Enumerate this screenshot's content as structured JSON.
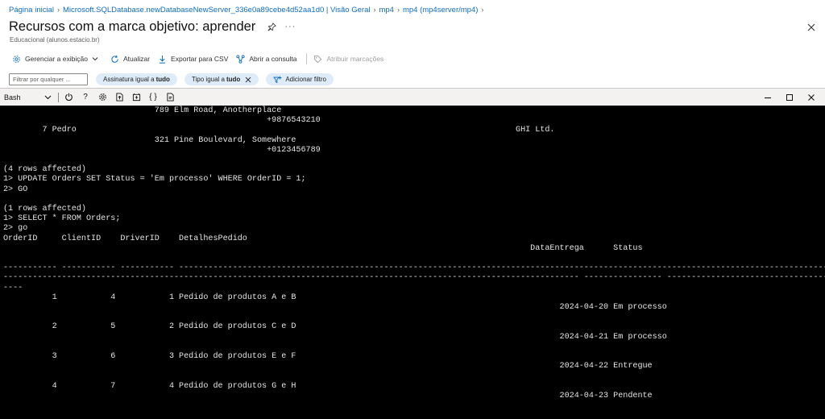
{
  "breadcrumb": {
    "items": [
      "Página inicial",
      "Microsoft.SQLDatabase.newDatabaseNewServer_336e0a89cebe4d52aa1d0 | Visão Geral",
      "mp4",
      "mp4 (mp4server/mp4)"
    ]
  },
  "header": {
    "title": "Recursos com a marca objetivo: aprender",
    "subtitle": "Educacional (alunos.estacio.br)",
    "more": "···"
  },
  "commandbar": {
    "manage_view": "Gerenciar a exibição",
    "refresh": "Atualizar",
    "export_csv": "Exportar para CSV",
    "open_query": "Abrir a consulta",
    "assign_tags": "Atribuir marcações"
  },
  "filters": {
    "search_placeholder": "Filtrar por qualquer ...",
    "subscription_label": "Assinatura igual a",
    "subscription_value": "tudo",
    "type_label": "Tipo igual a",
    "type_value": "tudo",
    "add_filter": "Adicionar filtro"
  },
  "shell": {
    "selected_shell": "Bash",
    "help": "?",
    "braces": "{ }"
  },
  "terminal": {
    "lines": [
      "                               789 Elm Road, Anotherplace",
      "                                                      +9876543210",
      "        7 Pedro                                                                                          GHI Ltd.",
      "                               321 Pine Boulevard, Somewhere",
      "                                                      +0123456789",
      "",
      "(4 rows affected)",
      "1> UPDATE Orders SET Status = 'Em processo' WHERE OrderID = 1;",
      "2> GO",
      "",
      "(1 rows affected)",
      "1> SELECT * FROM Orders;",
      "2> go",
      "OrderID     ClientID    DriverID    DetalhesPedido",
      "                                                                                                            DataEntrega      Status",
      "",
      "----------- ----------- ----------- ------------------------------------------------------------------------------------------------------------------------------------------------------------------------------------------------------------------------------------------------------------",
      "---------------------------------------------------------------------------------------------------------------------- ---------------- --------------------------------------------------------------------------------------------------------------------------------------------------------------",
      "----",
      "          1           4           1 Pedido de produtos A e B",
      "                                                                                                                  2024-04-20 Em processo",
      "",
      "          2           5           2 Pedido de produtos C e D",
      "                                                                                                                  2024-04-21 Em processo",
      "",
      "          3           6           3 Pedido de produtos E e F",
      "                                                                                                                  2024-04-22 Entregue",
      "",
      "          4           7           4 Pedido de produtos G e H",
      "                                                                                                                  2024-04-23 Pendente",
      ""
    ]
  },
  "colors": {
    "link": "#0f6cbd",
    "pill_bg": "#deecf9",
    "terminal_bg": "#000000",
    "terminal_fg": "#e6e6e6"
  }
}
